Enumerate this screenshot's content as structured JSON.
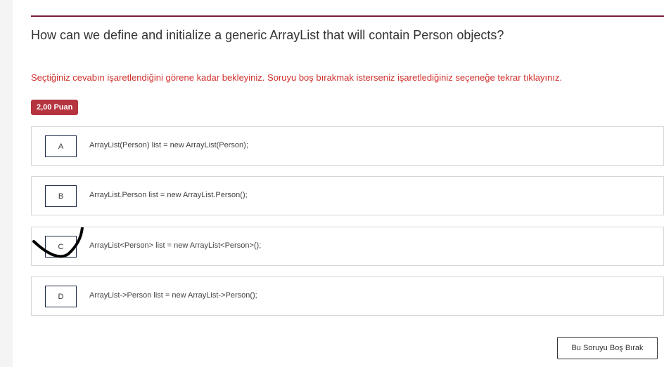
{
  "question": {
    "text": "How can we define and initialize a generic ArrayList that will contain Person objects?",
    "warning": "Seçtiğiniz cevabın işaretlendiğini görene kadar bekleyiniz. Soruyu boş bırakmak isterseniz işaretlediğiniz seçeneğe tekrar tıklayınız.",
    "points_badge": "2,00 Puan"
  },
  "options": [
    {
      "letter": "A",
      "text": "ArrayList(Person) list = new ArrayList(Person);"
    },
    {
      "letter": "B",
      "text": "ArrayList.Person list = new ArrayList.Person();"
    },
    {
      "letter": "C",
      "text": "ArrayList<Person> list = new ArrayList<Person>();"
    },
    {
      "letter": "D",
      "text": "ArrayList->Person list = new ArrayList->Person();"
    }
  ],
  "selected_option": "C",
  "skip_button_label": "Bu Soruyu Boş Bırak",
  "colors": {
    "accent_rule": "#7b1c3a",
    "warning_text": "#d0312d",
    "badge_bg": "#b5343f"
  }
}
